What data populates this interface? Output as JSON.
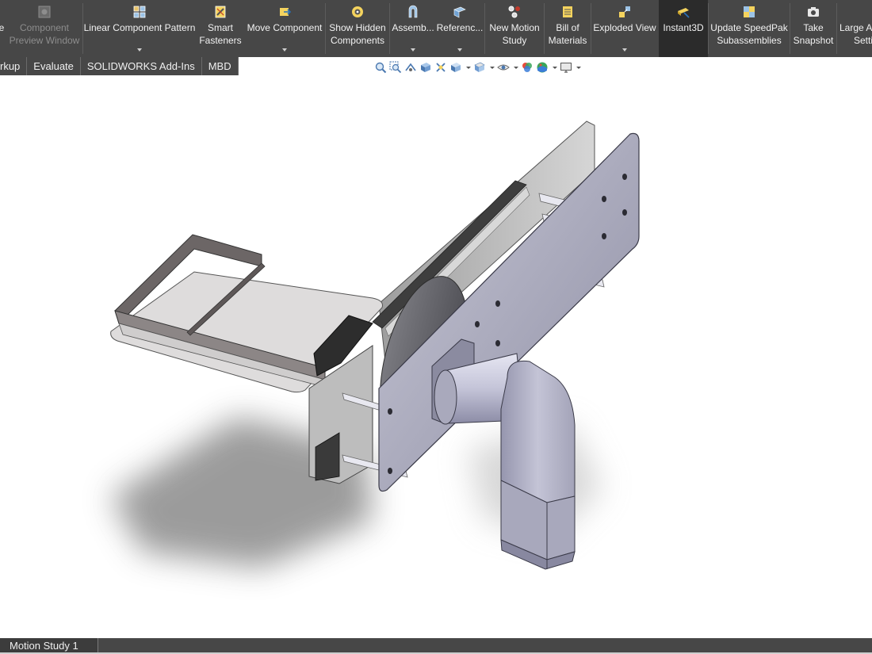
{
  "command_manager": {
    "buttons": [
      {
        "line1": "e",
        "line2": ""
      },
      {
        "line1": "Component",
        "line2": "Preview Window"
      },
      {
        "line1": "Linear Component Pattern",
        "line2": ""
      },
      {
        "line1": "Smart",
        "line2": "Fasteners"
      },
      {
        "line1": "Move Component",
        "line2": ""
      },
      {
        "line1": "Show Hidden",
        "line2": "Components"
      },
      {
        "line1": "Assemb...",
        "line2": ""
      },
      {
        "line1": "Referenc...",
        "line2": ""
      },
      {
        "line1": "New Motion",
        "line2": "Study"
      },
      {
        "line1": "Bill of",
        "line2": "Materials"
      },
      {
        "line1": "Exploded View",
        "line2": ""
      },
      {
        "line1": "Instant3D",
        "line2": ""
      },
      {
        "line1": "Update SpeedPak",
        "line2": "Subassemblies"
      },
      {
        "line1": "Take",
        "line2": "Snapshot"
      },
      {
        "line1": "Large As",
        "line2": "Setti"
      }
    ]
  },
  "tabs": [
    "rkup",
    "Evaluate",
    "SOLIDWORKS Add-Ins",
    "MBD"
  ],
  "motion_tabs": [
    "Motion Study 1"
  ],
  "colors": {
    "toolbar_bg": "#474747",
    "active_button_bg": "#2b2b2b",
    "text_light": "#f2f2f2",
    "text_disabled": "#8d8d8d",
    "viewport_bg": "#ffffff"
  }
}
